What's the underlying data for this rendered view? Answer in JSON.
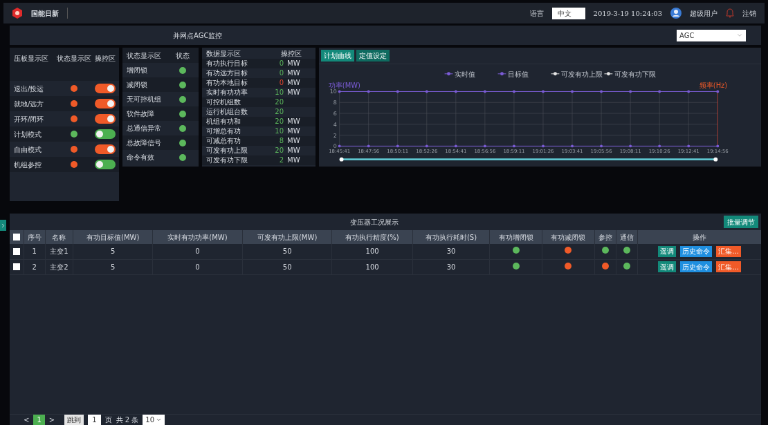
{
  "topbar": {
    "logo_text": "国能日新",
    "language_label": "语言",
    "language_value": "中文",
    "datetime": "2019-3-19  10:24:03",
    "user": "超级用户",
    "logout": "注销"
  },
  "header": {
    "title": "并网点AGC监控",
    "select_value": "AGC"
  },
  "plate_panel": {
    "columns": [
      "压板显示区",
      "状态显示区",
      "操控区"
    ],
    "rows": [
      {
        "label": "退出/投运",
        "color": "#f05a28",
        "on": true
      },
      {
        "label": "就地/远方",
        "color": "#f05a28",
        "on": true
      },
      {
        "label": "开环/闭环",
        "color": "#f05a28",
        "on": true
      },
      {
        "label": "计划模式",
        "color": "#5cb85c",
        "on": false
      },
      {
        "label": "自由模式",
        "color": "#f05a28",
        "on": true
      },
      {
        "label": "机组参控",
        "color": "#f05a28",
        "on": false
      }
    ]
  },
  "status_panel": {
    "columns": [
      "状态显示区",
      "状态"
    ],
    "rows": [
      {
        "label": "增闭锁",
        "color": "#5cb85c"
      },
      {
        "label": "减闭锁",
        "color": "#5cb85c"
      },
      {
        "label": "无可控机组",
        "color": "#5cb85c"
      },
      {
        "label": "软件故障",
        "color": "#5cb85c"
      },
      {
        "label": "总通信异常",
        "color": "#5cb85c"
      },
      {
        "label": "总故障信号",
        "color": "#5cb85c"
      },
      {
        "label": "命令有效",
        "color": "#5cb85c"
      }
    ]
  },
  "data_panel": {
    "columns": [
      "数据显示区",
      "操控区"
    ],
    "rows": [
      {
        "label": "有功执行目标",
        "value": "0",
        "unit": "MW",
        "warning": false
      },
      {
        "label": "有功远方目标",
        "value": "0",
        "unit": "MW",
        "warning": false
      },
      {
        "label": "有功本地目标",
        "value": "0",
        "unit": "MW",
        "warning": true
      },
      {
        "label": "实时有功功率",
        "value": "10",
        "unit": "MW",
        "warning": false
      },
      {
        "label": "可控机组数",
        "value": "20",
        "warning": false
      },
      {
        "label": "运行机组台数",
        "value": "20",
        "warning": false
      },
      {
        "label": "机组有功和",
        "value": "20",
        "unit": "MW",
        "warning": false
      },
      {
        "label": "可增总有功",
        "value": "10",
        "unit": "MW",
        "warning": false
      },
      {
        "label": "可减总有功",
        "value": "8",
        "unit": "MW",
        "warning": false
      },
      {
        "label": "可发有功上限",
        "value": "20",
        "unit": "MW",
        "warning": false
      },
      {
        "label": "可发有功下限",
        "value": "2",
        "unit": "MW",
        "warning": false
      }
    ]
  },
  "chart_panel": {
    "tabs": [
      {
        "label": "计划曲线",
        "selected": true
      },
      {
        "label": "定值设定",
        "selected": false
      }
    ],
    "right_axis_label": "频率(Hz)",
    "chart_data": {
      "type": "line",
      "ylabel": "功率(MW)",
      "grid": true,
      "legend": true,
      "x": [
        "18:45:41",
        "18:47:56",
        "18:50:11",
        "18:52:26",
        "18:54:41",
        "18:56:56",
        "18:59:11",
        "19:01:26",
        "19:03:41",
        "19:05:56",
        "19:08:11",
        "19:10:26",
        "19:12:41",
        "19:14:56"
      ],
      "series": [
        {
          "name": "实时值",
          "color": "#7b5cd6",
          "values": [
            10,
            10,
            10,
            10,
            10,
            10,
            10,
            10,
            10,
            10,
            10,
            10,
            10,
            10
          ]
        },
        {
          "name": "目标值",
          "color": "#7b5cd6",
          "values": [
            0,
            0,
            0,
            0,
            0,
            0,
            0,
            0,
            0,
            0,
            0,
            0,
            0,
            0
          ]
        },
        {
          "name": "可发有功上限",
          "color": "#e5e5e5",
          "values": [
            null,
            null,
            null,
            null,
            null,
            null,
            null,
            null,
            null,
            null,
            null,
            null,
            null,
            null
          ]
        },
        {
          "name": "可发有功下限",
          "color": "#e5e5e5",
          "values": [
            null,
            null,
            null,
            null,
            null,
            null,
            null,
            null,
            null,
            null,
            null,
            null,
            null,
            null
          ]
        }
      ],
      "ylim": [
        0,
        10
      ],
      "yticks": [
        0,
        2,
        4,
        6,
        8,
        10
      ]
    }
  },
  "table": {
    "title": "变压器工况展示",
    "batch_button": "批量调节",
    "columns": [
      {
        "kind": "checkbox",
        "checked": false
      },
      {
        "kind": "text",
        "label": "序号"
      },
      {
        "kind": "text",
        "label": "名称"
      },
      {
        "kind": "text",
        "label": "有功目标值(MW)"
      },
      {
        "kind": "text",
        "label": "实时有功功率(MW)"
      },
      {
        "kind": "text",
        "label": "可发有功上限(MW)"
      },
      {
        "kind": "text",
        "label": "有功执行精度(%)"
      },
      {
        "kind": "text",
        "label": "有功执行耗时(S)"
      },
      {
        "kind": "text",
        "label": "有功增闭锁"
      },
      {
        "kind": "text",
        "label": "有功减闭锁"
      },
      {
        "kind": "text",
        "label": "参控"
      },
      {
        "kind": "text",
        "label": "通信"
      },
      {
        "kind": "text",
        "label": "操作"
      }
    ],
    "rows": [
      {
        "cells": [
          {
            "kind": "checkbox",
            "checked": false
          },
          {
            "kind": "text",
            "text": "1"
          },
          {
            "kind": "text",
            "text": "主变1"
          },
          {
            "kind": "text",
            "text": "5"
          },
          {
            "kind": "text",
            "text": "0"
          },
          {
            "kind": "text",
            "text": "50"
          },
          {
            "kind": "text",
            "text": "100"
          },
          {
            "kind": "text",
            "text": "30"
          },
          {
            "kind": "dot",
            "color": "#5cb85c"
          },
          {
            "kind": "dot",
            "color": "#f05a28"
          },
          {
            "kind": "dot",
            "color": "#5cb85c"
          },
          {
            "kind": "dot",
            "color": "#5cb85c"
          },
          {
            "kind": "actions",
            "buttons": [
              {
                "label": "遥调",
                "color": "#13897a"
              },
              {
                "label": "历史命令",
                "color": "#1f8fe0"
              },
              {
                "label": "汇集...",
                "color": "#f05a28"
              }
            ]
          }
        ]
      },
      {
        "cells": [
          {
            "kind": "checkbox",
            "checked": false
          },
          {
            "kind": "text",
            "text": "2"
          },
          {
            "kind": "text",
            "text": "主变2"
          },
          {
            "kind": "text",
            "text": "5"
          },
          {
            "kind": "text",
            "text": "0"
          },
          {
            "kind": "text",
            "text": "50"
          },
          {
            "kind": "text",
            "text": "100"
          },
          {
            "kind": "text",
            "text": "30"
          },
          {
            "kind": "dot",
            "color": "#5cb85c"
          },
          {
            "kind": "dot",
            "color": "#f05a28"
          },
          {
            "kind": "dot",
            "color": "#f05a28"
          },
          {
            "kind": "dot",
            "color": "#5cb85c"
          },
          {
            "kind": "actions",
            "buttons": [
              {
                "label": "遥调",
                "color": "#13897a"
              },
              {
                "label": "历史命令",
                "color": "#1f8fe0"
              },
              {
                "label": "汇集...",
                "color": "#f05a28"
              }
            ]
          }
        ]
      }
    ]
  },
  "pagination": {
    "prev": "<",
    "pages": [
      {
        "label": "1",
        "selected": true
      }
    ],
    "next": ">",
    "jump_button": "跳到",
    "page_input": "1",
    "page_unit": "页",
    "total": "共 2 条",
    "page_size": "10"
  }
}
